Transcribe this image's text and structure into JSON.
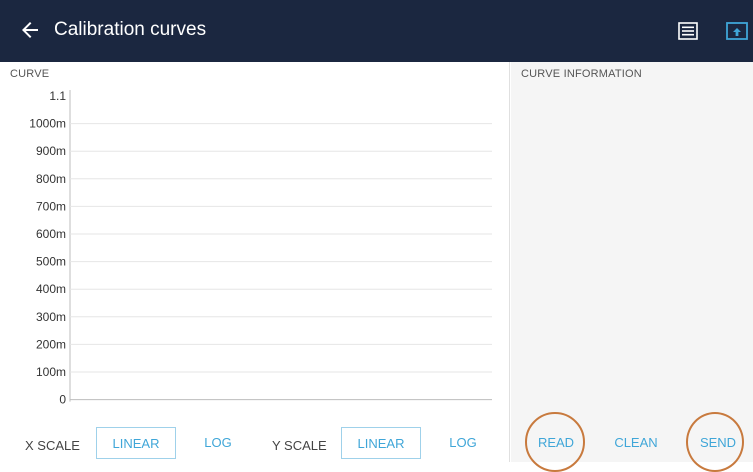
{
  "header": {
    "title": "Calibration curves",
    "background": "#1b2740"
  },
  "curve_panel": {
    "label": "CURVE"
  },
  "info_panel": {
    "label": "CURVE INFORMATION"
  },
  "chart_data": {
    "type": "line",
    "title": "",
    "xlabel": "",
    "ylabel": "",
    "y_ticks": [
      "1.1",
      "1000m",
      "900m",
      "800m",
      "700m",
      "600m",
      "500m",
      "400m",
      "300m",
      "200m",
      "100m",
      "0"
    ],
    "ylim": [
      0,
      1.1
    ],
    "grid": true,
    "series": []
  },
  "controls": {
    "x_scale_label": "X SCALE",
    "x_linear": "LINEAR",
    "x_log": "LOG",
    "y_scale_label": "Y SCALE",
    "y_linear": "LINEAR",
    "y_log": "LOG"
  },
  "actions": {
    "read": "READ",
    "clean": "CLEAN",
    "send": "SEND"
  },
  "colors": {
    "accent": "#3fa6d8",
    "highlight_circle": "#c87a3e"
  }
}
